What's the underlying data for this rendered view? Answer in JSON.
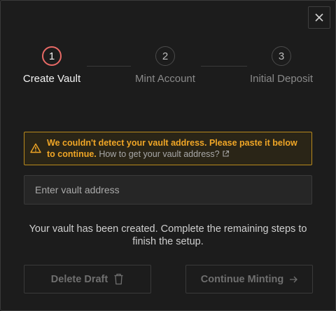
{
  "steps": [
    {
      "number": "1",
      "label": "Create Vault"
    },
    {
      "number": "2",
      "label": "Mint Account"
    },
    {
      "number": "3",
      "label": "Initial Deposit"
    }
  ],
  "alert": {
    "message": "We couldn't detect your vault address. Please paste it below to continue.",
    "link_text": "How to get your vault address?",
    "icon": "warning-icon",
    "color": "#f0a626"
  },
  "vault_input": {
    "placeholder": "Enter vault address",
    "value": ""
  },
  "info_text": "Your vault has been created. Complete the remaining steps to finish the setup.",
  "buttons": {
    "delete_label": "Delete Draft",
    "continue_label": "Continue Minting"
  },
  "colors": {
    "active_step": "#e86a66",
    "background": "#1c1c1c"
  }
}
